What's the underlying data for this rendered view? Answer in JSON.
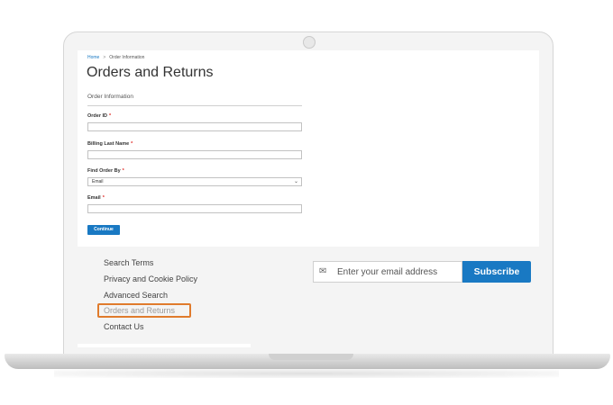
{
  "breadcrumb": {
    "home": "Home",
    "separator": ">",
    "current": "Order Information"
  },
  "page": {
    "title": "Orders and Returns"
  },
  "form": {
    "section_title": "Order Information",
    "order_id_label": "Order ID",
    "last_name_label": "Billing Last Name",
    "find_by_label": "Find Order By",
    "find_by_value": "Email",
    "email_label": "Email",
    "required_mark": "*",
    "continue_label": "Continue"
  },
  "footer": {
    "links": [
      "Search Terms",
      "Privacy and Cookie Policy",
      "Advanced Search",
      "Orders and Returns",
      "Contact Us"
    ],
    "highlighted_link": "Orders and Returns",
    "newsletter": {
      "placeholder": "Enter your email address",
      "button": "Subscribe"
    }
  },
  "colors": {
    "accent": "#1979c3",
    "highlight": "#e07b2c",
    "required": "#e02b27"
  }
}
